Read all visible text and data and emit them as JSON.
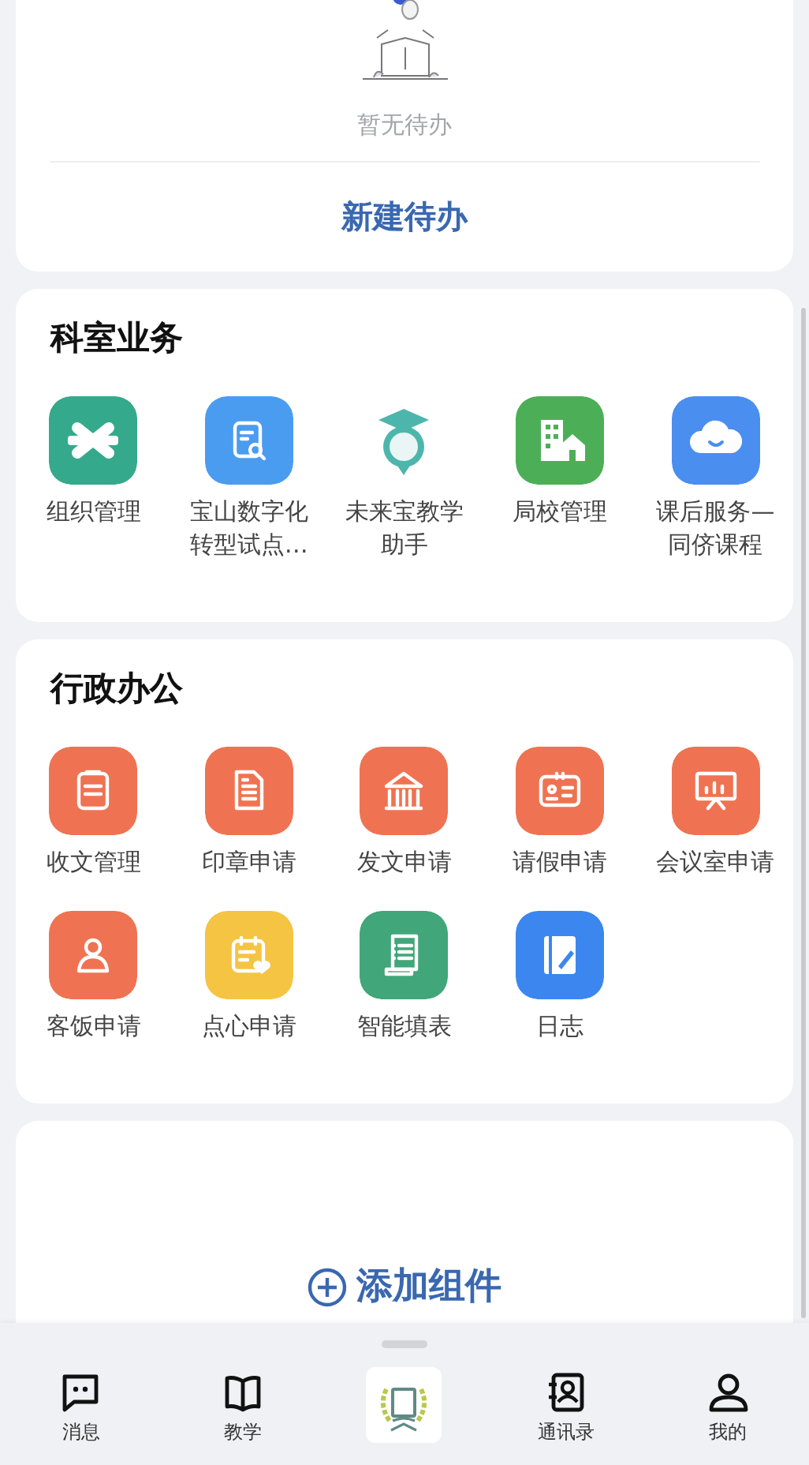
{
  "todo": {
    "empty_text": "暂无待办",
    "action": "新建待办"
  },
  "sections": [
    {
      "title": "科室业务",
      "apps": [
        {
          "label": "组织管理",
          "color": "#35a98c"
        },
        {
          "label": "宝山数字化转型试点…",
          "color": "#4a9cf0"
        },
        {
          "label": "未来宝教学助手",
          "color": "#4db6ac"
        },
        {
          "label": "局校管理",
          "color": "#4caf57"
        },
        {
          "label": "课后服务—同侪课程",
          "color": "#4a8ef0"
        }
      ]
    },
    {
      "title": "行政办公",
      "apps": [
        {
          "label": "收文管理",
          "color": "#ef7352"
        },
        {
          "label": "印章申请",
          "color": "#ef7352"
        },
        {
          "label": "发文申请",
          "color": "#ef7352"
        },
        {
          "label": "请假申请",
          "color": "#ef7352"
        },
        {
          "label": "会议室申请",
          "color": "#ef7352"
        },
        {
          "label": "客饭申请",
          "color": "#ef7352"
        },
        {
          "label": "点心申请",
          "color": "#f5c443"
        },
        {
          "label": "智能填表",
          "color": "#41a679"
        },
        {
          "label": "日志",
          "color": "#3b87ef"
        }
      ]
    }
  ],
  "widget": {
    "action": "添加组件"
  },
  "nav": [
    {
      "kind": "tab",
      "label": "消息"
    },
    {
      "kind": "tab",
      "label": "教学"
    },
    {
      "kind": "logo"
    },
    {
      "kind": "tab",
      "label": "通讯录"
    },
    {
      "kind": "tab",
      "label": "我的"
    }
  ]
}
